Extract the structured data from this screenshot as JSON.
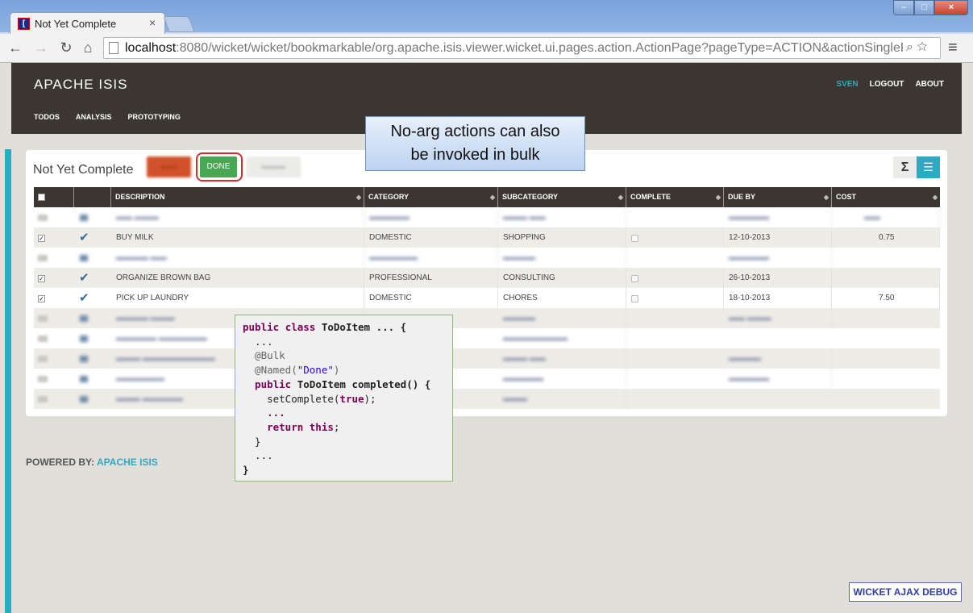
{
  "browser": {
    "tab_title": "Not Yet Complete",
    "favicon_glyph": "[",
    "url_host": "localhost",
    "url_rest": ":8080/wicket/wicket/bookmarkable/org.apache.isis.viewer.wicket.ui.pages.action.ActionPage?pageType=ACTION&actionSingleResu"
  },
  "app": {
    "brand": "APACHE ISIS",
    "user": "SVEN",
    "logout": "LOGOUT",
    "about": "ABOUT",
    "menu": [
      "TODOS",
      "ANALYSIS",
      "PROTOTYPING"
    ]
  },
  "panel": {
    "title": "Not Yet Complete",
    "done_label": "DONE",
    "sigma_glyph": "Σ",
    "list_glyph": "☰"
  },
  "table": {
    "columns": [
      "DESCRIPTION",
      "CATEGORY",
      "SUBCATEGORY",
      "COMPLETE",
      "DUE BY",
      "COST"
    ],
    "visible_rows": [
      {
        "description": "BUY MILK",
        "category": "DOMESTIC",
        "subcategory": "SHOPPING",
        "due_by": "12-10-2013",
        "cost": "0.75"
      },
      {
        "description": "ORGANIZE BROWN BAG",
        "category": "PROFESSIONAL",
        "subcategory": "CONSULTING",
        "due_by": "26-10-2013",
        "cost": ""
      },
      {
        "description": "PICK UP LAUNDRY",
        "category": "DOMESTIC",
        "subcategory": "CHORES",
        "due_by": "18-10-2013",
        "cost": "7.50"
      }
    ]
  },
  "callout": {
    "line1": "No-arg actions can also",
    "line2": "be invoked in bulk"
  },
  "code": {
    "l1_kw1": "public",
    "l1_kw2": "class",
    "l1_rest": " ToDoItem ... {",
    "l2": "  ...",
    "l3": "  @Bulk",
    "l4_ann": "  @Named(",
    "l4_str": "\"Done\"",
    "l4_end": ")",
    "l5_kw": "  public",
    "l5_rest": " ToDoItem completed() {",
    "l6_a": "    setComplete(",
    "l6_kw": "true",
    "l6_b": ");",
    "l7": "    ...",
    "l8_kw": "    return this",
    "l8_b": ";",
    "l9": "  }",
    "l10": "  ...",
    "l11": "}"
  },
  "footer": {
    "powered_prefix": "POWERED BY: ",
    "powered_link": "APACHE ISIS",
    "debug": "WICKET AJAX DEBUG"
  },
  "colors": {
    "accent": "#2da9c2",
    "navbar": "#3b3630",
    "done_green": "#47a753",
    "highlight_red": "#d52c2c"
  }
}
